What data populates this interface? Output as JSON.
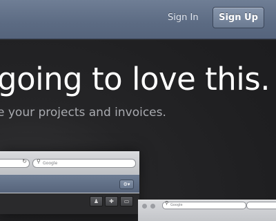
{
  "nav": {
    "sign_in": "Sign In",
    "sign_up": "Sign Up"
  },
  "hero": {
    "headline": "going to love this.",
    "subline": "e your projects and invoices."
  },
  "browser": {
    "search_placeholder": "Google",
    "icons": [
      "reload-icon",
      "search-icon",
      "gear-icon",
      "add-contact-icon",
      "new-document-icon",
      "trash-icon"
    ]
  },
  "colors": {
    "topbar": "#5f6e86",
    "background": "#1f1f21",
    "headline": "#ffffff",
    "subline": "#a9abb0"
  }
}
